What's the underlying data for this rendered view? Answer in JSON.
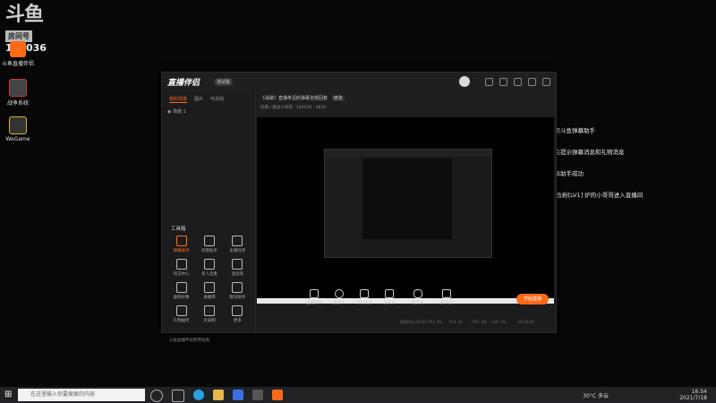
{
  "desktop": {
    "room_badge": {
      "logo": "斗鱼",
      "label": "房间号",
      "number": "146036"
    },
    "icons": [
      {
        "label": "斗鱼直播伴侣",
        "icon": "douyu-companion-icon"
      },
      {
        "label": "战争系统",
        "icon": "game-icon"
      },
      {
        "label": "WeGame",
        "icon": "wegame-icon"
      }
    ],
    "chat_overlay": [
      "欢迎使用斗鱼弹幕助手",
      "本区域会提示弹幕消息和礼物消息",
      "添加弹幕助手成功",
      "欢迎 斗鱼粉[LV1] 炉的小哥哥进入直播间"
    ]
  },
  "app": {
    "title": "直播伴侣",
    "version_badge": "测试版",
    "left_tabs": [
      "我的场景",
      "图片",
      "可添加"
    ],
    "scene_label": "场景 1",
    "tools_title": "工具箱",
    "tools": [
      {
        "label": "弹幕助手",
        "icon": "chat-icon",
        "active": true
      },
      {
        "label": "房管助手",
        "icon": "user-icon"
      },
      {
        "label": "主播任务",
        "icon": "task-icon"
      },
      {
        "label": "玩法中心",
        "icon": "game-center-icon"
      },
      {
        "label": "多人连麦",
        "icon": "download-icon"
      },
      {
        "label": "团战等",
        "icon": "team-icon"
      },
      {
        "label": "虚拟形象",
        "icon": "avatar-icon"
      },
      {
        "label": "录播库",
        "icon": "record-icon"
      },
      {
        "label": "歌词助手",
        "icon": "lyrics-icon"
      },
      {
        "label": "礼物抽奖",
        "icon": "gift-icon"
      },
      {
        "label": "云录制",
        "icon": "cloud-icon"
      },
      {
        "label": "更多",
        "icon": "more-icon"
      }
    ],
    "footer_tip": "斗鱼直播伴侣使用指南",
    "room_title": "《战歌》直播朱迅的弹幕全部回复",
    "room_edit": "修改",
    "room_meta": "经典 / 搬加小哥哥 · 146036 · 5834",
    "controls": [
      "直播屏幕",
      "摄像头",
      "手机投屏",
      "多媒体",
      "麦克风",
      "扬声器"
    ],
    "live_button": "开始直播",
    "status": [
      "直播时长 00:00",
      "CPU: 0%",
      "FPS: 00",
      "CPU: 4%",
      "内存: 3%",
      "00:00:00"
    ]
  },
  "taskbar": {
    "search_placeholder": "在这里输入你要搜索的内容",
    "weather": "30°C 多云",
    "time": "16:54",
    "date": "2021/7/18"
  }
}
